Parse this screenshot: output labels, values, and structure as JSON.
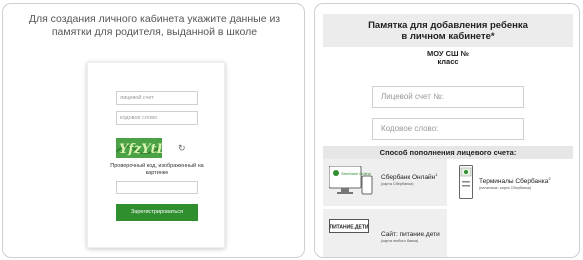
{
  "left": {
    "instruction": "Для создания личного кабинета укажите данные из памятки для родителя, выданной в школе",
    "account_placeholder": "лицевой счет",
    "code_placeholder": "кодовое слово",
    "captcha_text": "YfzYtB",
    "captcha_note": "Проверочный код, изображенный на картинке",
    "register_label": "Зарегистрироваться"
  },
  "right": {
    "title_line1": "Памятка для добавления ребенка",
    "title_line2": "в личном кабинете*",
    "school_line1": "МОУ СШ №",
    "school_line2": "класс",
    "account_label": "Лицевой счет №:",
    "code_label": "Кодовое слово:",
    "payment_title": "Способ пополнения лицевого счета:",
    "methods": [
      {
        "title": "Сбербанк Онлайн",
        "sup": "1",
        "note": "(карта Сбербанка)",
        "icon": "sberbank-online-icon",
        "icon_text": "Sberbank Online"
      },
      {
        "title": "Терминалы Сбербанка",
        "sup": "2",
        "note": "(наличные, карта Сбербанка)",
        "icon": "terminal-icon"
      },
      {
        "title": "Сайт: питание.дети",
        "sup": "",
        "note": "(карта любого банка)",
        "icon": "pitanie-deti-logo-icon",
        "icon_text": "ПИТАНИЕ.ДЕТИ"
      }
    ]
  },
  "colors": {
    "green": "#2f8f2f",
    "captcha_green": "#4aa244",
    "gray_header": "#ececec"
  }
}
